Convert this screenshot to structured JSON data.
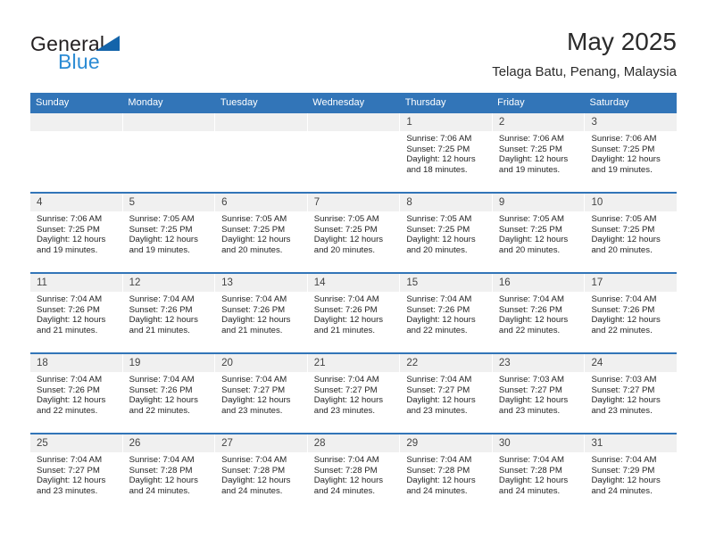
{
  "brand": {
    "word1": "General",
    "word2": "Blue",
    "triangle_color": "#1464aa",
    "blue_color": "#2b8bd4"
  },
  "header": {
    "title": "May 2025",
    "subtitle": "Telaga Batu, Penang, Malaysia"
  },
  "theme": {
    "header_bg": "#3275b8",
    "day_strip_bg": "#f0f0f0",
    "cell_bg": "#ffffff"
  },
  "calendar": {
    "weekdays": [
      "Sunday",
      "Monday",
      "Tuesday",
      "Wednesday",
      "Thursday",
      "Friday",
      "Saturday"
    ],
    "weeks": [
      [
        {
          "day": "",
          "empty": true
        },
        {
          "day": "",
          "empty": true
        },
        {
          "day": "",
          "empty": true
        },
        {
          "day": "",
          "empty": true
        },
        {
          "day": "1",
          "sunrise": "Sunrise: 7:06 AM",
          "sunset": "Sunset: 7:25 PM",
          "daylight1": "Daylight: 12 hours",
          "daylight2": "and 18 minutes."
        },
        {
          "day": "2",
          "sunrise": "Sunrise: 7:06 AM",
          "sunset": "Sunset: 7:25 PM",
          "daylight1": "Daylight: 12 hours",
          "daylight2": "and 19 minutes."
        },
        {
          "day": "3",
          "sunrise": "Sunrise: 7:06 AM",
          "sunset": "Sunset: 7:25 PM",
          "daylight1": "Daylight: 12 hours",
          "daylight2": "and 19 minutes."
        }
      ],
      [
        {
          "day": "4",
          "sunrise": "Sunrise: 7:06 AM",
          "sunset": "Sunset: 7:25 PM",
          "daylight1": "Daylight: 12 hours",
          "daylight2": "and 19 minutes."
        },
        {
          "day": "5",
          "sunrise": "Sunrise: 7:05 AM",
          "sunset": "Sunset: 7:25 PM",
          "daylight1": "Daylight: 12 hours",
          "daylight2": "and 19 minutes."
        },
        {
          "day": "6",
          "sunrise": "Sunrise: 7:05 AM",
          "sunset": "Sunset: 7:25 PM",
          "daylight1": "Daylight: 12 hours",
          "daylight2": "and 20 minutes."
        },
        {
          "day": "7",
          "sunrise": "Sunrise: 7:05 AM",
          "sunset": "Sunset: 7:25 PM",
          "daylight1": "Daylight: 12 hours",
          "daylight2": "and 20 minutes."
        },
        {
          "day": "8",
          "sunrise": "Sunrise: 7:05 AM",
          "sunset": "Sunset: 7:25 PM",
          "daylight1": "Daylight: 12 hours",
          "daylight2": "and 20 minutes."
        },
        {
          "day": "9",
          "sunrise": "Sunrise: 7:05 AM",
          "sunset": "Sunset: 7:25 PM",
          "daylight1": "Daylight: 12 hours",
          "daylight2": "and 20 minutes."
        },
        {
          "day": "10",
          "sunrise": "Sunrise: 7:05 AM",
          "sunset": "Sunset: 7:25 PM",
          "daylight1": "Daylight: 12 hours",
          "daylight2": "and 20 minutes."
        }
      ],
      [
        {
          "day": "11",
          "sunrise": "Sunrise: 7:04 AM",
          "sunset": "Sunset: 7:26 PM",
          "daylight1": "Daylight: 12 hours",
          "daylight2": "and 21 minutes."
        },
        {
          "day": "12",
          "sunrise": "Sunrise: 7:04 AM",
          "sunset": "Sunset: 7:26 PM",
          "daylight1": "Daylight: 12 hours",
          "daylight2": "and 21 minutes."
        },
        {
          "day": "13",
          "sunrise": "Sunrise: 7:04 AM",
          "sunset": "Sunset: 7:26 PM",
          "daylight1": "Daylight: 12 hours",
          "daylight2": "and 21 minutes."
        },
        {
          "day": "14",
          "sunrise": "Sunrise: 7:04 AM",
          "sunset": "Sunset: 7:26 PM",
          "daylight1": "Daylight: 12 hours",
          "daylight2": "and 21 minutes."
        },
        {
          "day": "15",
          "sunrise": "Sunrise: 7:04 AM",
          "sunset": "Sunset: 7:26 PM",
          "daylight1": "Daylight: 12 hours",
          "daylight2": "and 22 minutes."
        },
        {
          "day": "16",
          "sunrise": "Sunrise: 7:04 AM",
          "sunset": "Sunset: 7:26 PM",
          "daylight1": "Daylight: 12 hours",
          "daylight2": "and 22 minutes."
        },
        {
          "day": "17",
          "sunrise": "Sunrise: 7:04 AM",
          "sunset": "Sunset: 7:26 PM",
          "daylight1": "Daylight: 12 hours",
          "daylight2": "and 22 minutes."
        }
      ],
      [
        {
          "day": "18",
          "sunrise": "Sunrise: 7:04 AM",
          "sunset": "Sunset: 7:26 PM",
          "daylight1": "Daylight: 12 hours",
          "daylight2": "and 22 minutes."
        },
        {
          "day": "19",
          "sunrise": "Sunrise: 7:04 AM",
          "sunset": "Sunset: 7:26 PM",
          "daylight1": "Daylight: 12 hours",
          "daylight2": "and 22 minutes."
        },
        {
          "day": "20",
          "sunrise": "Sunrise: 7:04 AM",
          "sunset": "Sunset: 7:27 PM",
          "daylight1": "Daylight: 12 hours",
          "daylight2": "and 23 minutes."
        },
        {
          "day": "21",
          "sunrise": "Sunrise: 7:04 AM",
          "sunset": "Sunset: 7:27 PM",
          "daylight1": "Daylight: 12 hours",
          "daylight2": "and 23 minutes."
        },
        {
          "day": "22",
          "sunrise": "Sunrise: 7:04 AM",
          "sunset": "Sunset: 7:27 PM",
          "daylight1": "Daylight: 12 hours",
          "daylight2": "and 23 minutes."
        },
        {
          "day": "23",
          "sunrise": "Sunrise: 7:03 AM",
          "sunset": "Sunset: 7:27 PM",
          "daylight1": "Daylight: 12 hours",
          "daylight2": "and 23 minutes."
        },
        {
          "day": "24",
          "sunrise": "Sunrise: 7:03 AM",
          "sunset": "Sunset: 7:27 PM",
          "daylight1": "Daylight: 12 hours",
          "daylight2": "and 23 minutes."
        }
      ],
      [
        {
          "day": "25",
          "sunrise": "Sunrise: 7:04 AM",
          "sunset": "Sunset: 7:27 PM",
          "daylight1": "Daylight: 12 hours",
          "daylight2": "and 23 minutes."
        },
        {
          "day": "26",
          "sunrise": "Sunrise: 7:04 AM",
          "sunset": "Sunset: 7:28 PM",
          "daylight1": "Daylight: 12 hours",
          "daylight2": "and 24 minutes."
        },
        {
          "day": "27",
          "sunrise": "Sunrise: 7:04 AM",
          "sunset": "Sunset: 7:28 PM",
          "daylight1": "Daylight: 12 hours",
          "daylight2": "and 24 minutes."
        },
        {
          "day": "28",
          "sunrise": "Sunrise: 7:04 AM",
          "sunset": "Sunset: 7:28 PM",
          "daylight1": "Daylight: 12 hours",
          "daylight2": "and 24 minutes."
        },
        {
          "day": "29",
          "sunrise": "Sunrise: 7:04 AM",
          "sunset": "Sunset: 7:28 PM",
          "daylight1": "Daylight: 12 hours",
          "daylight2": "and 24 minutes."
        },
        {
          "day": "30",
          "sunrise": "Sunrise: 7:04 AM",
          "sunset": "Sunset: 7:28 PM",
          "daylight1": "Daylight: 12 hours",
          "daylight2": "and 24 minutes."
        },
        {
          "day": "31",
          "sunrise": "Sunrise: 7:04 AM",
          "sunset": "Sunset: 7:29 PM",
          "daylight1": "Daylight: 12 hours",
          "daylight2": "and 24 minutes."
        }
      ]
    ]
  }
}
